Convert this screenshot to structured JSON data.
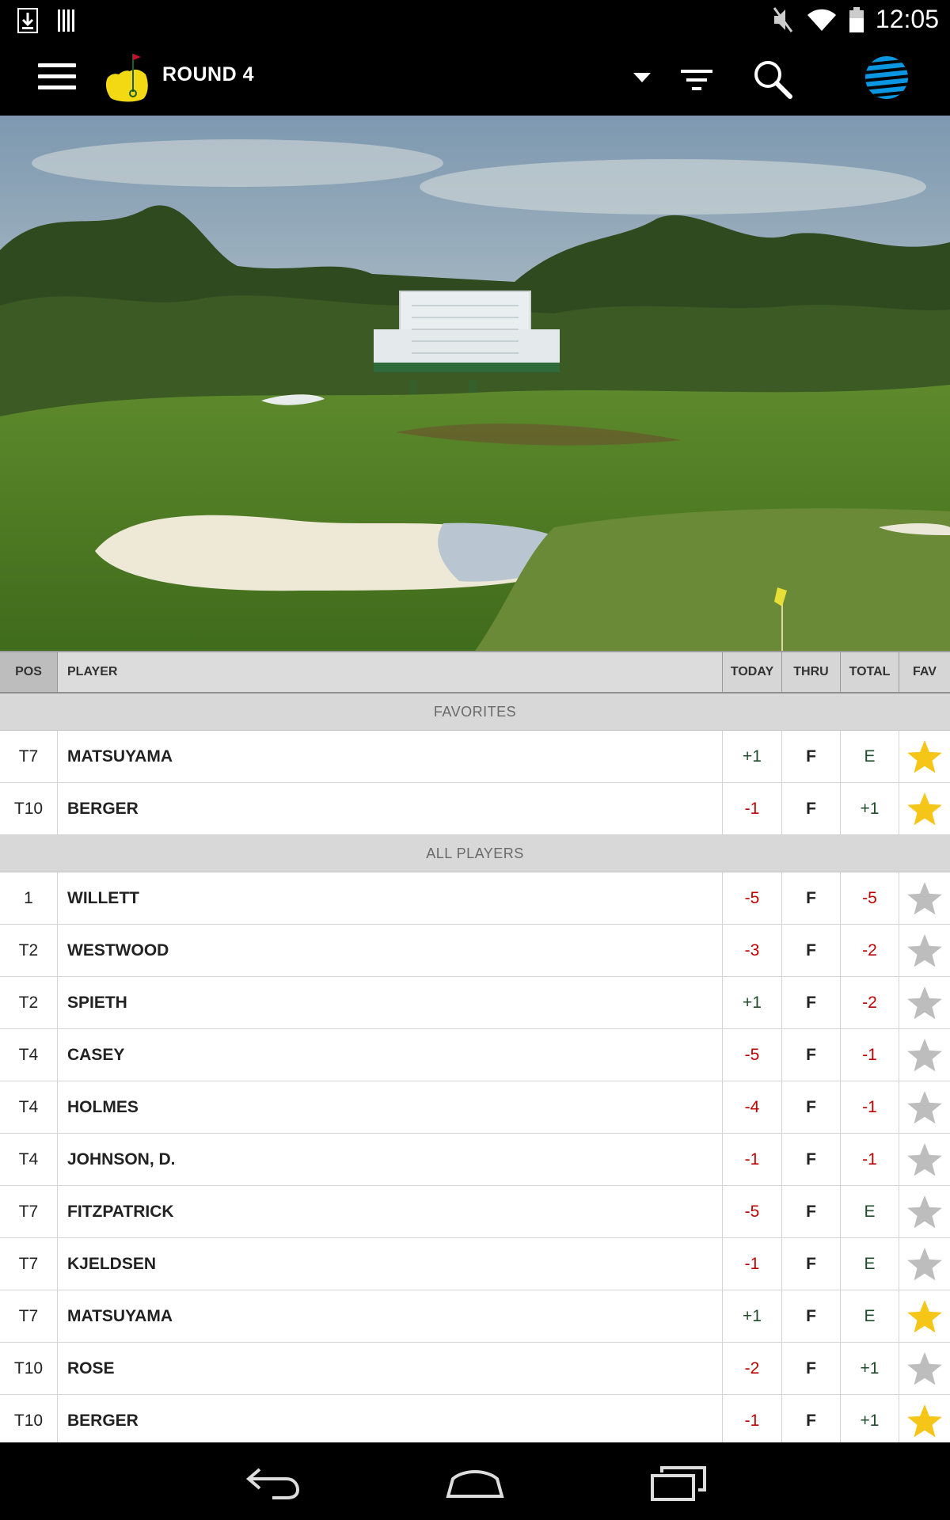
{
  "status_bar": {
    "time": "12:05"
  },
  "app_bar": {
    "title": "ROUND 4"
  },
  "table": {
    "headers": {
      "pos": "POS",
      "player": "PLAYER",
      "today": "TODAY",
      "thru": "THRU",
      "total": "TOTAL",
      "fav": "FAV"
    },
    "favorites_label": "FAVORITES",
    "all_players_label": "ALL PLAYERS",
    "favorites": [
      {
        "pos": "T7",
        "player": "MATSUYAMA",
        "today": "+1",
        "thru": "F",
        "total": "E",
        "fav": true
      },
      {
        "pos": "T10",
        "player": "BERGER",
        "today": "-1",
        "thru": "F",
        "total": "+1",
        "fav": true
      }
    ],
    "all_players": [
      {
        "pos": "1",
        "player": "WILLETT",
        "today": "-5",
        "thru": "F",
        "total": "-5",
        "fav": false
      },
      {
        "pos": "T2",
        "player": "WESTWOOD",
        "today": "-3",
        "thru": "F",
        "total": "-2",
        "fav": false
      },
      {
        "pos": "T2",
        "player": "SPIETH",
        "today": "+1",
        "thru": "F",
        "total": "-2",
        "fav": false
      },
      {
        "pos": "T4",
        "player": "CASEY",
        "today": "-5",
        "thru": "F",
        "total": "-1",
        "fav": false
      },
      {
        "pos": "T4",
        "player": "HOLMES",
        "today": "-4",
        "thru": "F",
        "total": "-1",
        "fav": false
      },
      {
        "pos": "T4",
        "player": "JOHNSON, D.",
        "today": "-1",
        "thru": "F",
        "total": "-1",
        "fav": false
      },
      {
        "pos": "T7",
        "player": "FITZPATRICK",
        "today": "-5",
        "thru": "F",
        "total": "E",
        "fav": false
      },
      {
        "pos": "T7",
        "player": "KJELDSEN",
        "today": "-1",
        "thru": "F",
        "total": "E",
        "fav": false
      },
      {
        "pos": "T7",
        "player": "MATSUYAMA",
        "today": "+1",
        "thru": "F",
        "total": "E",
        "fav": true
      },
      {
        "pos": "T10",
        "player": "ROSE",
        "today": "-2",
        "thru": "F",
        "total": "+1",
        "fav": false
      },
      {
        "pos": "T10",
        "player": "BERGER",
        "today": "-1",
        "thru": "F",
        "total": "+1",
        "fav": true
      }
    ]
  },
  "colors": {
    "negative": "#c00000",
    "non_negative": "#1f4d2c",
    "fav_on": "#f5c518",
    "fav_off": "#bdbdbd"
  }
}
